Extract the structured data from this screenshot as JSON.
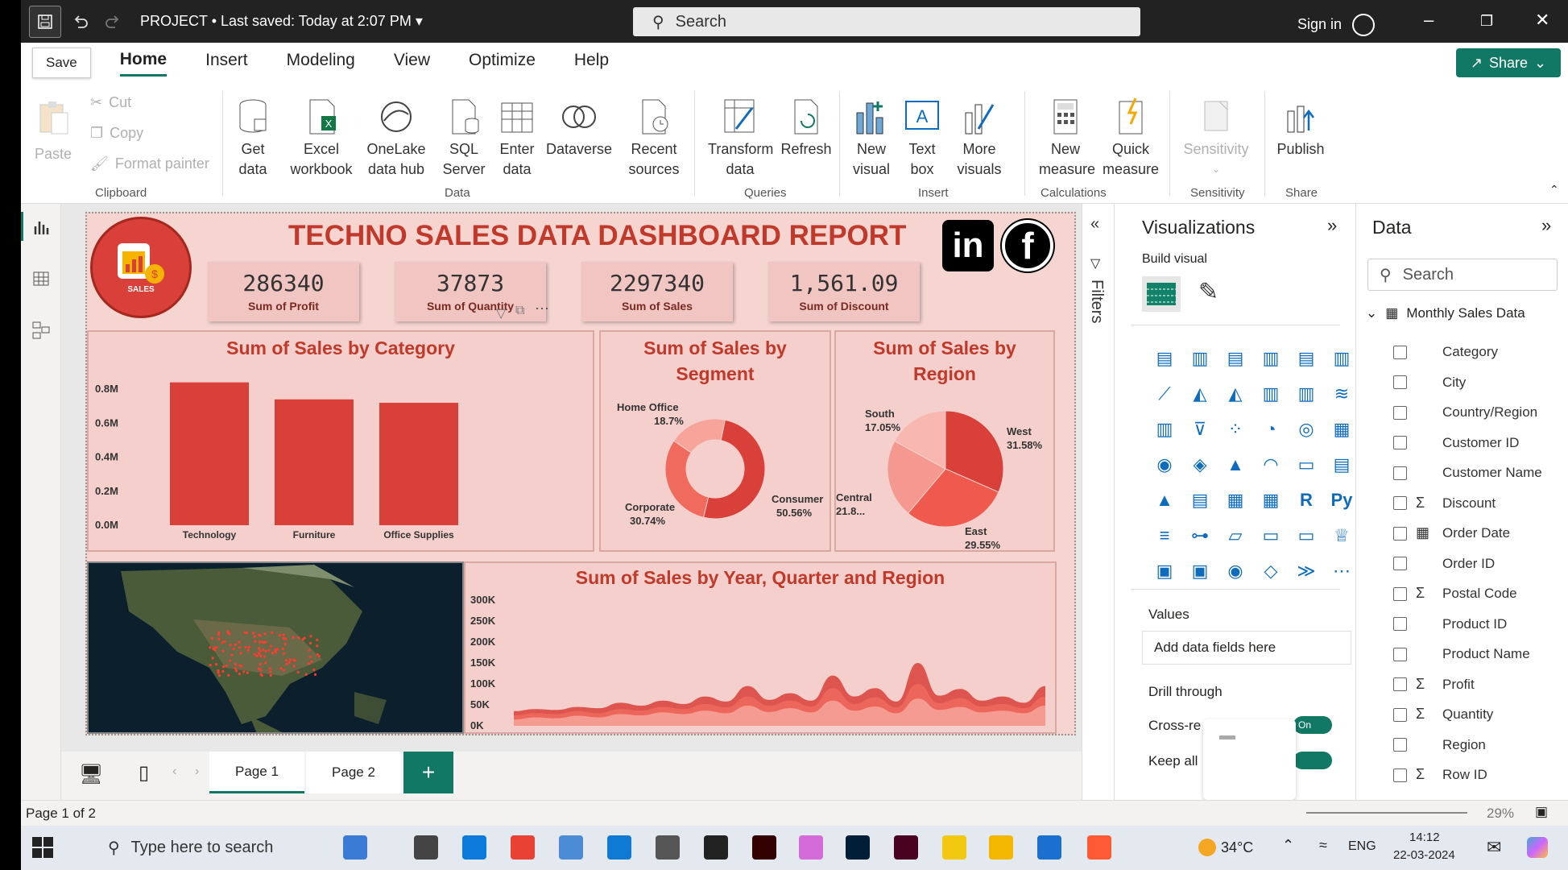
{
  "titlebar": {
    "project": "PROJECT",
    "saved": "•  Last saved: Today at 2:07 PM",
    "search_placeholder": "Search",
    "signin": "Sign in"
  },
  "tabs": {
    "save_tip": "Save",
    "items": [
      "Home",
      "Insert",
      "Modeling",
      "View",
      "Optimize",
      "Help"
    ],
    "share": "Share"
  },
  "ribbon": {
    "clipboard": {
      "paste": "Paste",
      "cut": "Cut",
      "copy": "Copy",
      "format": "Format painter",
      "group": "Clipboard"
    },
    "data": {
      "get": "Get data",
      "excel": "Excel workbook",
      "onelake": "OneLake data hub",
      "sql": "SQL Server",
      "enter": "Enter data",
      "dataverse": "Dataverse",
      "recent": "Recent sources",
      "group": "Data"
    },
    "queries": {
      "transform": "Transform data",
      "refresh": "Refresh",
      "group": "Queries"
    },
    "insert": {
      "new_visual": "New visual",
      "textbox": "Text box",
      "more": "More visuals",
      "group": "Insert"
    },
    "calc": {
      "new_measure": "New measure",
      "quick": "Quick measure",
      "group": "Calculations"
    },
    "sens": {
      "label": "Sensitivity",
      "group": "Sensitivity"
    },
    "share": {
      "publish": "Publish",
      "group": "Share"
    }
  },
  "report": {
    "title": "TECHNO SALES DATA DASHBOARD REPORT",
    "logo_text": "SALES",
    "kpis": [
      {
        "value": "286340",
        "label": "Sum of Profit"
      },
      {
        "value": "37873",
        "label": "Sum of Quantity"
      },
      {
        "value": "2297340",
        "label": "Sum of Sales"
      },
      {
        "value": "1,561.09",
        "label": "Sum of Discount"
      }
    ],
    "category_title": "Sum of Sales by Category",
    "segment_title": "Sum of Sales by Segment",
    "region_title": "Sum of Sales by Region",
    "trend_title": "Sum of Sales by Year, Quarter and Region"
  },
  "chart_data": [
    {
      "type": "bar",
      "title": "Sum of Sales by Category",
      "categories": [
        "Technology",
        "Furniture",
        "Office Supplies"
      ],
      "values": [
        0.84,
        0.74,
        0.72
      ],
      "yticks": [
        "0.8M",
        "0.6M",
        "0.4M",
        "0.2M",
        "0.0M"
      ],
      "ylim": [
        0,
        0.9
      ],
      "color": "#d9403a"
    },
    {
      "type": "pie",
      "subtype": "donut",
      "title": "Sum of Sales by Segment",
      "labels": [
        "Consumer",
        "Corporate",
        "Home Office"
      ],
      "values": [
        50.56,
        30.74,
        18.7
      ],
      "display": [
        "50.56%",
        "30.74%",
        "18.7%"
      ],
      "colors": [
        "#d9403a",
        "#f06a5e",
        "#f7a49a"
      ]
    },
    {
      "type": "pie",
      "title": "Sum of Sales by Region",
      "labels": [
        "West",
        "East",
        "Central",
        "South"
      ],
      "values": [
        31.58,
        29.55,
        21.82,
        17.05
      ],
      "display": [
        "31.58%",
        "29.55%",
        "21.8...",
        "17.05%"
      ],
      "colors": [
        "#d9403a",
        "#f05a4e",
        "#f59890",
        "#f8b7b0"
      ]
    },
    {
      "type": "area",
      "title": "Sum of Sales by Year, Quarter and Region",
      "yticks": [
        "300K",
        "250K",
        "200K",
        "150K",
        "100K",
        "50K",
        "0K"
      ],
      "ylim": [
        0,
        300
      ],
      "series": [
        {
          "values": [
            35,
            40,
            38,
            45,
            42,
            55,
            48,
            60,
            52,
            70,
            58,
            95,
            62,
            78,
            60,
            120,
            70,
            90,
            58,
            150,
            72,
            88,
            60,
            70,
            55,
            95
          ],
          "color": "#d9403a"
        },
        {
          "values": [
            25,
            30,
            28,
            35,
            30,
            40,
            36,
            45,
            40,
            52,
            44,
            70,
            48,
            60,
            46,
            90,
            52,
            68,
            44,
            100,
            54,
            66,
            46,
            52,
            42,
            70
          ],
          "color": "#f06a5e"
        },
        {
          "values": [
            15,
            20,
            18,
            24,
            20,
            28,
            25,
            32,
            28,
            36,
            30,
            48,
            33,
            42,
            32,
            60,
            36,
            46,
            30,
            65,
            38,
            45,
            32,
            36,
            30,
            48
          ],
          "color": "#f7a49a"
        }
      ]
    }
  ],
  "viz": {
    "title": "Visualizations",
    "build": "Build visual",
    "values": "Values",
    "add": "Add data fields here",
    "drill": "Drill through",
    "cross": "Cross-re",
    "keep": "Keep all",
    "on": "On",
    "filters": "Filters"
  },
  "data_pane": {
    "title": "Data",
    "search": "Search",
    "table": "Monthly Sales Data",
    "fields": [
      "Category",
      "City",
      "Country/Region",
      "Customer ID",
      "Customer Name",
      "Discount",
      "Order Date",
      "Order ID",
      "Postal Code",
      "Product ID",
      "Product Name",
      "Profit",
      "Quantity",
      "Region",
      "Row ID"
    ]
  },
  "pages": {
    "p1": "Page 1",
    "p2": "Page 2",
    "status": "Page 1 of 2",
    "zoom": "29%"
  },
  "taskbar": {
    "search": "Type here to search",
    "temp": "34°C",
    "lang": "ENG",
    "time": "14:12",
    "date": "22-03-2024"
  }
}
